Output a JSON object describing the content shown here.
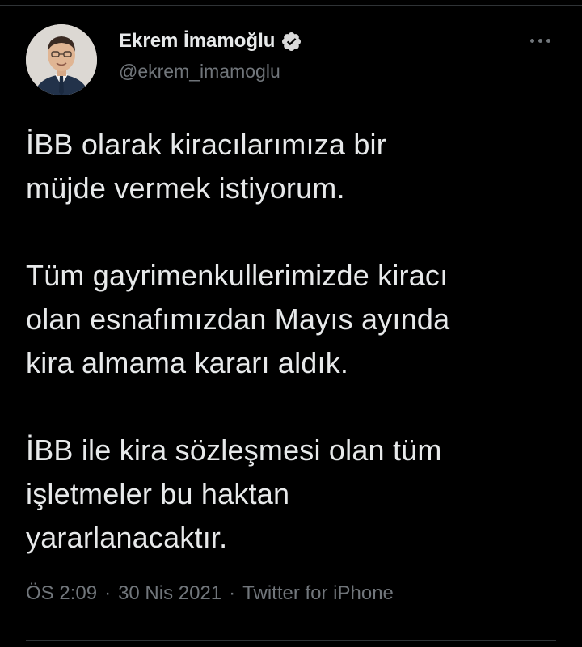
{
  "author": {
    "display_name": "Ekrem İmamoğlu",
    "handle": "@ekrem_imamoglu",
    "verified": true
  },
  "tweet": {
    "paragraphs": [
      [
        "İBB olarak kiracılarımıza bir",
        "müjde vermek istiyorum."
      ],
      [
        "Tüm gayrimenkullerimizde kiracı",
        "olan esnafımızdan Mayıs ayında",
        "kira almama kararı aldık."
      ],
      [
        "İBB ile kira sözleşmesi olan tüm",
        "işletmeler bu haktan",
        "yararlanacaktır."
      ]
    ],
    "time": "ÖS 2:09",
    "separator": "·",
    "date": "30 Nis 2021",
    "source": "Twitter for iPhone"
  },
  "icons": {
    "verified": "verified-badge-icon",
    "more": "more-options-icon"
  },
  "colors": {
    "background": "#000000",
    "text_primary": "#e7e9ea",
    "text_secondary": "#71767b",
    "divider": "#2f3336"
  }
}
